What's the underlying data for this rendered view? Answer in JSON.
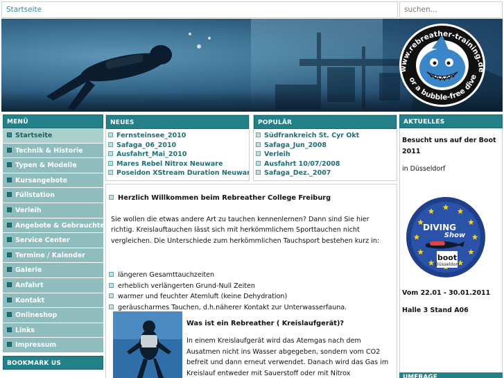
{
  "header": {
    "breadcrumb": "Startseite",
    "search_placeholder": "suchen..."
  },
  "banner": {
    "logo_text_top": "www.rebreather-training.de",
    "logo_text_bottom": "for a bubble-free dive"
  },
  "menu": {
    "title": "MENÜ",
    "items": [
      {
        "label": "Startseite",
        "active": true
      },
      {
        "label": "Technik & Historie"
      },
      {
        "label": "Typen & Modelle"
      },
      {
        "label": "Kursangebote"
      },
      {
        "label": "Füllstation"
      },
      {
        "label": "Verleih"
      },
      {
        "label": "Angebote & Gebrauchtes"
      },
      {
        "label": "Service Center"
      },
      {
        "label": "Termine / Kalender"
      },
      {
        "label": "Galerie"
      },
      {
        "label": "Anfahrt"
      },
      {
        "label": "Kontakt"
      },
      {
        "label": "Onlineshop"
      },
      {
        "label": "Links"
      },
      {
        "label": "Impressum"
      }
    ]
  },
  "bookmark": {
    "title": "BOOKMARK US"
  },
  "neues": {
    "title": "NEUES",
    "items": [
      "Fernsteinsee_2010",
      "Safaga_06_2010",
      "Ausfahrt_Mai_2010",
      "Mares Rebel Nitrox Neuware",
      "Poseidon XStream Duration Neuware"
    ]
  },
  "populaer": {
    "title": "POPULÄR",
    "items": [
      "Südfrankreich St. Cyr Okt",
      "Safaga_Jun_2008",
      "Verleih",
      "Ausfahrt 10/07/2008",
      "Safaga_Dez._2007"
    ]
  },
  "content": {
    "welcome": "Herzlich Willkommen beim Rebreather College Freiburg",
    "intro": "Sie wollen die etwas andere Art zu tauchen kennenlernen? Dann sind Sie hier richtig. Kreislauftauchen lässt sich mit herkömmlichem Sporttauchen nicht vergleichen. Die Unterschiede zum herkömmlichen Tauchsport bestehen kurz in:",
    "bullets": [
      "längeren Gesamttauchzeiten",
      "erheblich verlängerten Grund-Null Zeiten",
      "warmer und feuchter Atemluft (keine Dehydration)",
      "geräuscharmes Tauchen, d.h.näherer Kontakt zur Unterwasserfauna."
    ],
    "rebreather_title": "Was ist ein Rebreather ( Kreislaufgerät)?",
    "rebreather_text": "In einem Kreislaufgerät wird das Atemgas nach dem Ausatmen nicht ins Wasser abgegeben, sondern vom CO2 befreit und dann erneut verwendet. Danach wird das Gas im Kreislauf entweder mit Sauerstoff oder mit Nitrox angereichert um wieder ein atembares"
  },
  "aktuelles": {
    "title": "AKTUELLES",
    "boot_title": "Besucht uns auf der Boot 2011",
    "city": "in Düsseldorf",
    "logo_diving": "DIVING",
    "logo_show": "Show",
    "logo_boot": "boot",
    "logo_city": "Düsseldorf",
    "date": "Vom 22.01 - 30.01.2011",
    "hall": "Halle 3 Stand A06"
  },
  "umfrage": {
    "title": "UMFRAGE"
  }
}
